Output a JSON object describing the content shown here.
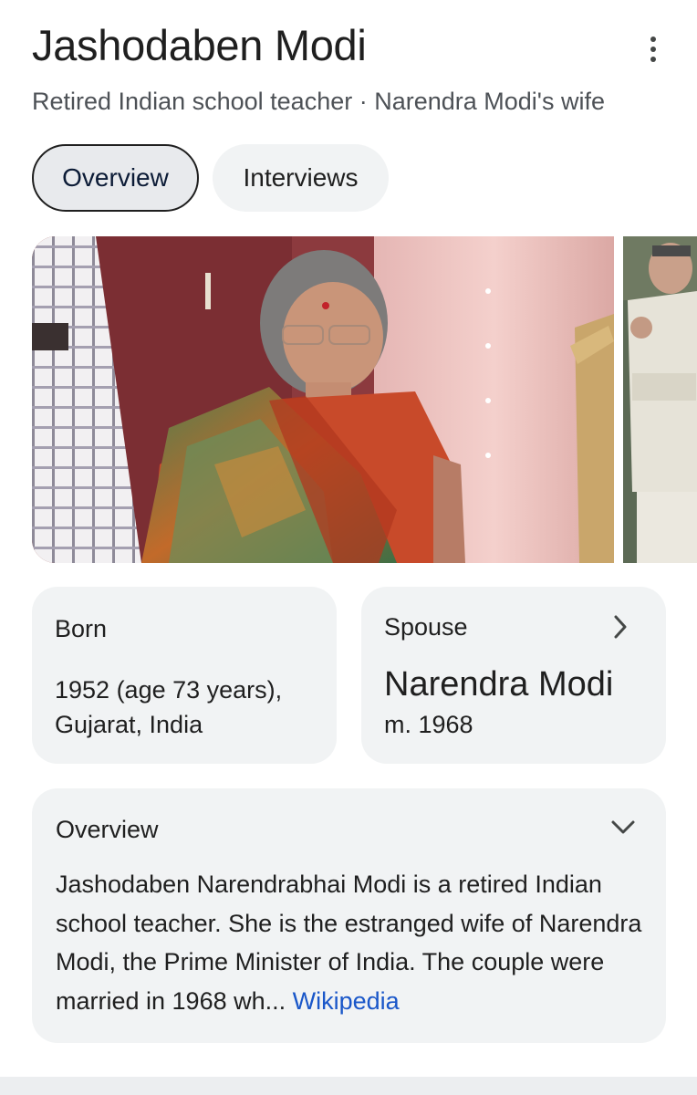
{
  "header": {
    "title": "Jashodaben Modi",
    "subtitle": "Retired Indian school teacher · Narendra Modi's wife",
    "more_icon": "more-vert-icon"
  },
  "tabs": [
    {
      "label": "Overview",
      "active": true
    },
    {
      "label": "Interviews",
      "active": false
    }
  ],
  "born_card": {
    "label": "Born",
    "line1": "1952 (age 73 years),",
    "line2": "Gujarat, India"
  },
  "spouse_card": {
    "label": "Spouse",
    "name": "Narendra Modi",
    "married": "m. 1968",
    "chevron_icon": "chevron-right-icon"
  },
  "overview_card": {
    "label": "Overview",
    "text": "Jashodaben Narendrabhai Modi is a retired Indian school teacher. She is the estranged wife of Narendra Modi, the Prime Minister of India. The couple were married in 1968 wh...",
    "source_link": "Wikipedia",
    "chevron_icon": "chevron-down-icon"
  },
  "colors": {
    "accent_link": "#1a57c9",
    "card_bg": "#f1f3f4",
    "active_tab_border": "#1f1f1f"
  }
}
